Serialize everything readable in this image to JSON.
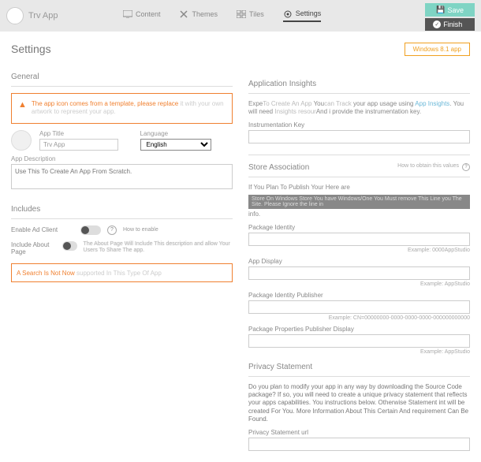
{
  "header": {
    "app_title": "Trv App",
    "tabs": {
      "content": "Content",
      "themes": "Themes",
      "tiles": "Tiles",
      "settings": "Settings"
    },
    "save": "Save",
    "finish": "Finish"
  },
  "page_title": "Settings",
  "win_badge": "Windows 8.1 app",
  "general": {
    "heading": "General",
    "warn": "The app icon comes from a template, please replace",
    "warn_faded": " it with your own artwork to represent your app.",
    "app_title_lbl": "App Title",
    "app_title_val": "Trv App",
    "lang_lbl": "Language",
    "lang_val": "English",
    "desc_lbl": "App Description",
    "desc_ph": "Use This To Create An App From Scratch."
  },
  "includes": {
    "heading": "Includes",
    "ad_lbl": "Enable Ad Client",
    "how": "How to enable",
    "about_lbl": "Include About Page",
    "about_desc": "The About Page Will Include This description and allow Your Users To Share The app.",
    "search_warn": "A Search Is Not Now ",
    "search_faded": "supported In This Type Of App"
  },
  "insights": {
    "heading": "Application Insights",
    "text1": "Expe",
    "text1b": "To Create An App",
    "text2": "You",
    "text2b": "can Track",
    "text3": " your app usage using ",
    "link": "App Insights",
    "text4": ". You will need",
    "text5": " Insights resour",
    "text5b": "And i",
    "text6": " provide the instrumentation key.",
    "key_lbl": "Instrumentation Key"
  },
  "store": {
    "heading": "Store Association",
    "qhelp": "How to obtain this values",
    "text1": "If You Plan To Publish Your Here are ",
    "bar": "Store On Windows Store You have Windows/One You Must remove This Line you The Site. Please Ignore the line in",
    "text2": " info.",
    "pkg_lbl": "Package Identity",
    "pkg_ex": "Example: 0000AppStudio",
    "disp_lbl": "App Display",
    "disp_ex": "Example: AppStudio",
    "pub_lbl": "Package Identity Publisher",
    "pub_ex": "Example: CN=00000000-0000-0000-0000-000000000000",
    "pubdisp_lbl": "Package Properties Publisher Display",
    "pubdisp_ex": "Example: AppStudio"
  },
  "privacy": {
    "heading": "Privacy Statement",
    "text": "Do you plan to modify your app in any way by downloading the Source Code package? If so, you will need to create a unique privacy statement that reflects your apps capabilities. You instructions below. Otherwise Statement int will be created For You. More Information About This Certain And requirement Can Be Found.",
    "url_lbl": "Privacy Statement url"
  }
}
